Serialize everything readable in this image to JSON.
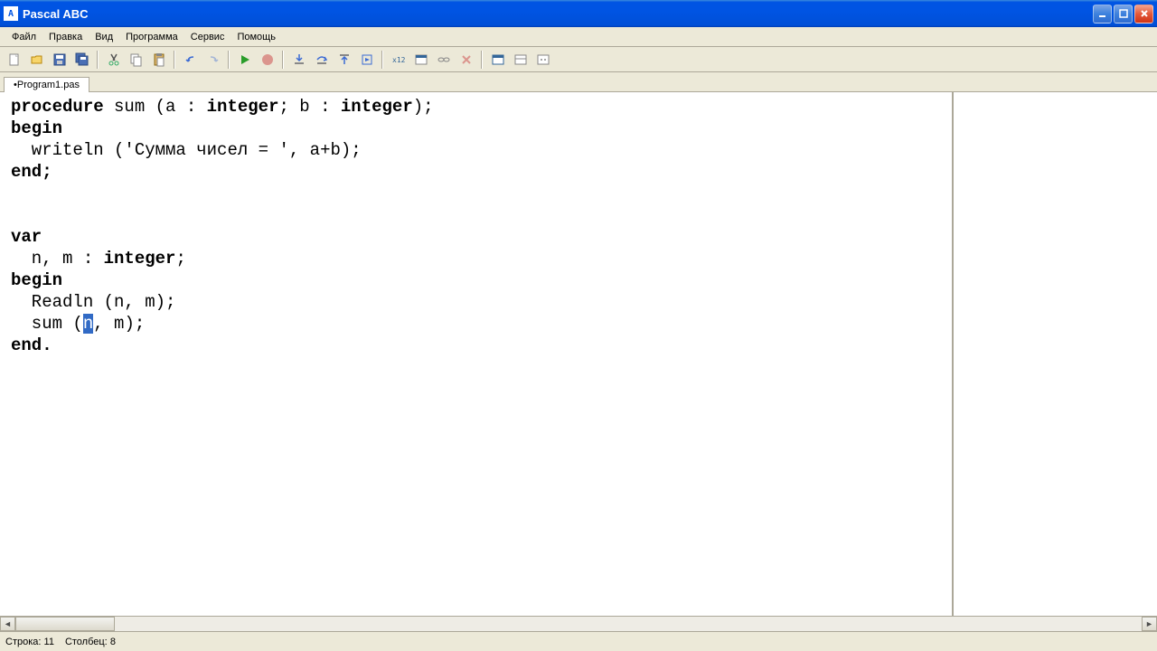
{
  "title": "Pascal ABC",
  "menu": {
    "file": "Файл",
    "edit": "Правка",
    "view": "Вид",
    "program": "Программа",
    "service": "Сервис",
    "help": "Помощь"
  },
  "tab": "•Program1.pas",
  "code": {
    "l1a": "procedure",
    "l1b": " sum (a : ",
    "l1c": "integer",
    "l1d": "; b : ",
    "l1e": "integer",
    "l1f": ");",
    "l2": "begin",
    "l3a": "  writeln (",
    "l3b": "'Сумма чисел = '",
    "l3c": ", a+b);",
    "l4": "end;",
    "l5": "",
    "l6": "",
    "l7": "var",
    "l8a": "  n, m : ",
    "l8b": "integer",
    "l8c": ";",
    "l9": "begin",
    "l10": "  Readln (n, m);",
    "l11a": "  sum (",
    "l11sel": "n",
    "l11b": ", m);",
    "l12": "end."
  },
  "status": {
    "line_label": "Строка:",
    "line": "11",
    "col_label": "Столбец:",
    "col": "8"
  }
}
